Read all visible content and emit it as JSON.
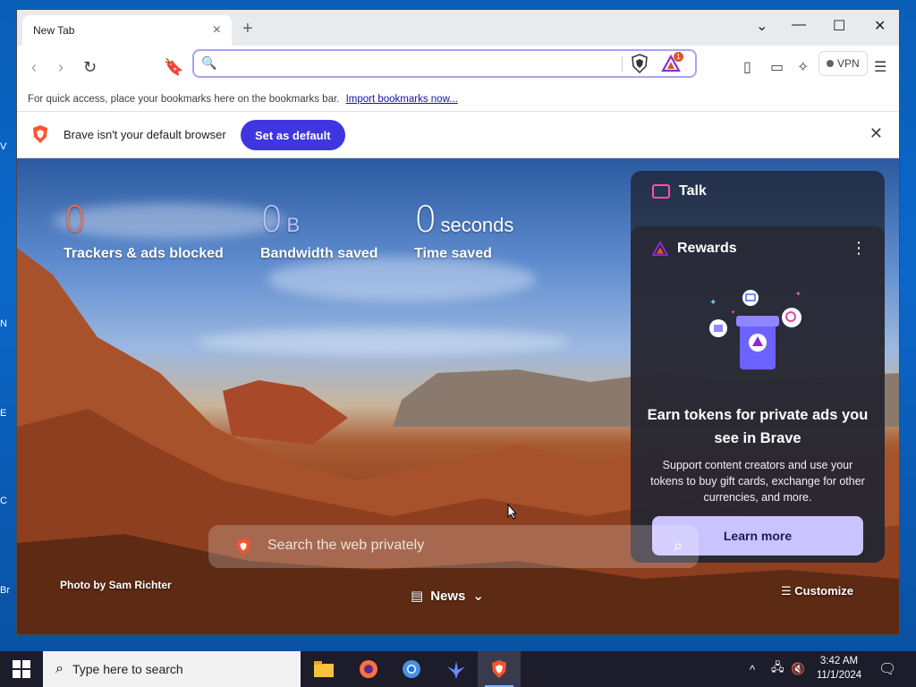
{
  "desktop": {
    "fragments": [
      "V",
      "N",
      "E",
      "C",
      "Br"
    ]
  },
  "browser": {
    "tab_title": "New Tab",
    "tab_close": "×",
    "new_tab": "+",
    "win_controls": {
      "dropdown": "⌄",
      "minimize": "—",
      "maximize": "☐",
      "close": "✕"
    },
    "omnibox": {
      "value": "",
      "rewards_badge": "1"
    },
    "vpn_label": "VPN",
    "bookmarks_bar": {
      "text": "For quick access, place your bookmarks here on the bookmarks bar.",
      "link": "Import bookmarks now..."
    },
    "infobar": {
      "text": "Brave isn't your default browser",
      "button": "Set as default",
      "close": "✕"
    }
  },
  "ntp": {
    "stats": {
      "trackers": {
        "value": "0",
        "label": "Trackers & ads blocked"
      },
      "bandwidth": {
        "value": "0",
        "unit": "B",
        "label": "Bandwidth saved"
      },
      "time": {
        "value": "0",
        "unit": "seconds",
        "label": "Time saved"
      }
    },
    "talk": {
      "label": "Talk"
    },
    "rewards": {
      "label": "Rewards",
      "more": "⋮",
      "title": "Earn tokens for private ads you see in Brave",
      "body": "Support content creators and use your tokens to buy gift cards, exchange for other currencies, and more.",
      "button": "Learn more"
    },
    "search": {
      "placeholder": "Search the web privately"
    },
    "photo_credit": "Photo by Sam Richter",
    "news": {
      "label": "News",
      "chevron": "⌄"
    },
    "customize": "Customize"
  },
  "taskbar": {
    "search_placeholder": "Type here to search",
    "clock": {
      "time": "3:42 AM",
      "date": "11/1/2024"
    }
  },
  "colors": {
    "brave_orange": "#fb542b",
    "set_default_purple": "#3f36e0",
    "trackers_red": "#ff6b4a",
    "bandwidth_lavender": "#b9c4ff",
    "learn_more_bg": "#c9c3ff"
  }
}
